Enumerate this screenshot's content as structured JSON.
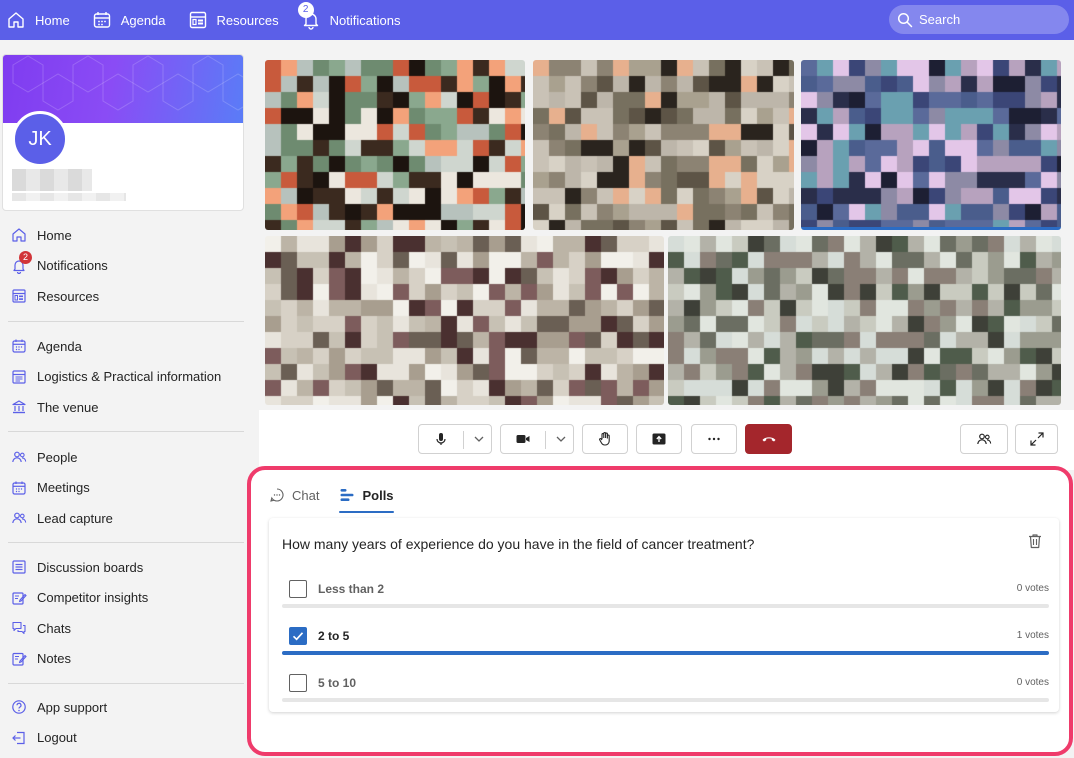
{
  "topbar": {
    "home": "Home",
    "agenda": "Agenda",
    "resources": "Resources",
    "notifications": "Notifications",
    "notifications_count": "2",
    "search_placeholder": "Search"
  },
  "profile": {
    "initials": "JK"
  },
  "sidebar": {
    "group1": [
      {
        "label": "Home",
        "icon": "home-icon"
      },
      {
        "label": "Notifications",
        "icon": "bell-icon",
        "badge": "2"
      },
      {
        "label": "Resources",
        "icon": "resources-icon"
      }
    ],
    "group2": [
      {
        "label": "Agenda",
        "icon": "calendar-icon"
      },
      {
        "label": "Logistics & Practical information",
        "icon": "info-board-icon"
      },
      {
        "label": "The venue",
        "icon": "building-icon"
      }
    ],
    "group3": [
      {
        "label": "People",
        "icon": "people-icon"
      },
      {
        "label": "Meetings",
        "icon": "calendar-icon"
      },
      {
        "label": "Lead capture",
        "icon": "people-icon"
      }
    ],
    "group4": [
      {
        "label": "Discussion boards",
        "icon": "board-icon"
      },
      {
        "label": "Competitor insights",
        "icon": "edit-icon"
      },
      {
        "label": "Chats",
        "icon": "chat-icon"
      },
      {
        "label": "Notes",
        "icon": "notes-icon"
      }
    ],
    "group5": [
      {
        "label": "App support",
        "icon": "help-icon"
      },
      {
        "label": "Logout",
        "icon": "logout-icon"
      }
    ]
  },
  "meeting": {
    "tabs": {
      "chat": "Chat",
      "polls": "Polls"
    },
    "poll": {
      "question": "How many years of experience do you have in the field of cancer treatment?",
      "options": [
        {
          "label": "Less than 2",
          "votes": "0 votes",
          "checked": false,
          "share": 0
        },
        {
          "label": "2 to 5",
          "votes": "1 votes",
          "checked": true,
          "share": 1
        },
        {
          "label": "5 to 10",
          "votes": "0 votes",
          "checked": false,
          "share": 0
        }
      ]
    }
  },
  "colors": {
    "topbar": "#5b5fe8",
    "accent": "#2b6cc4",
    "highlight_border": "#ef3b6b",
    "end_call": "#a4262c",
    "badge": "#d13438"
  }
}
